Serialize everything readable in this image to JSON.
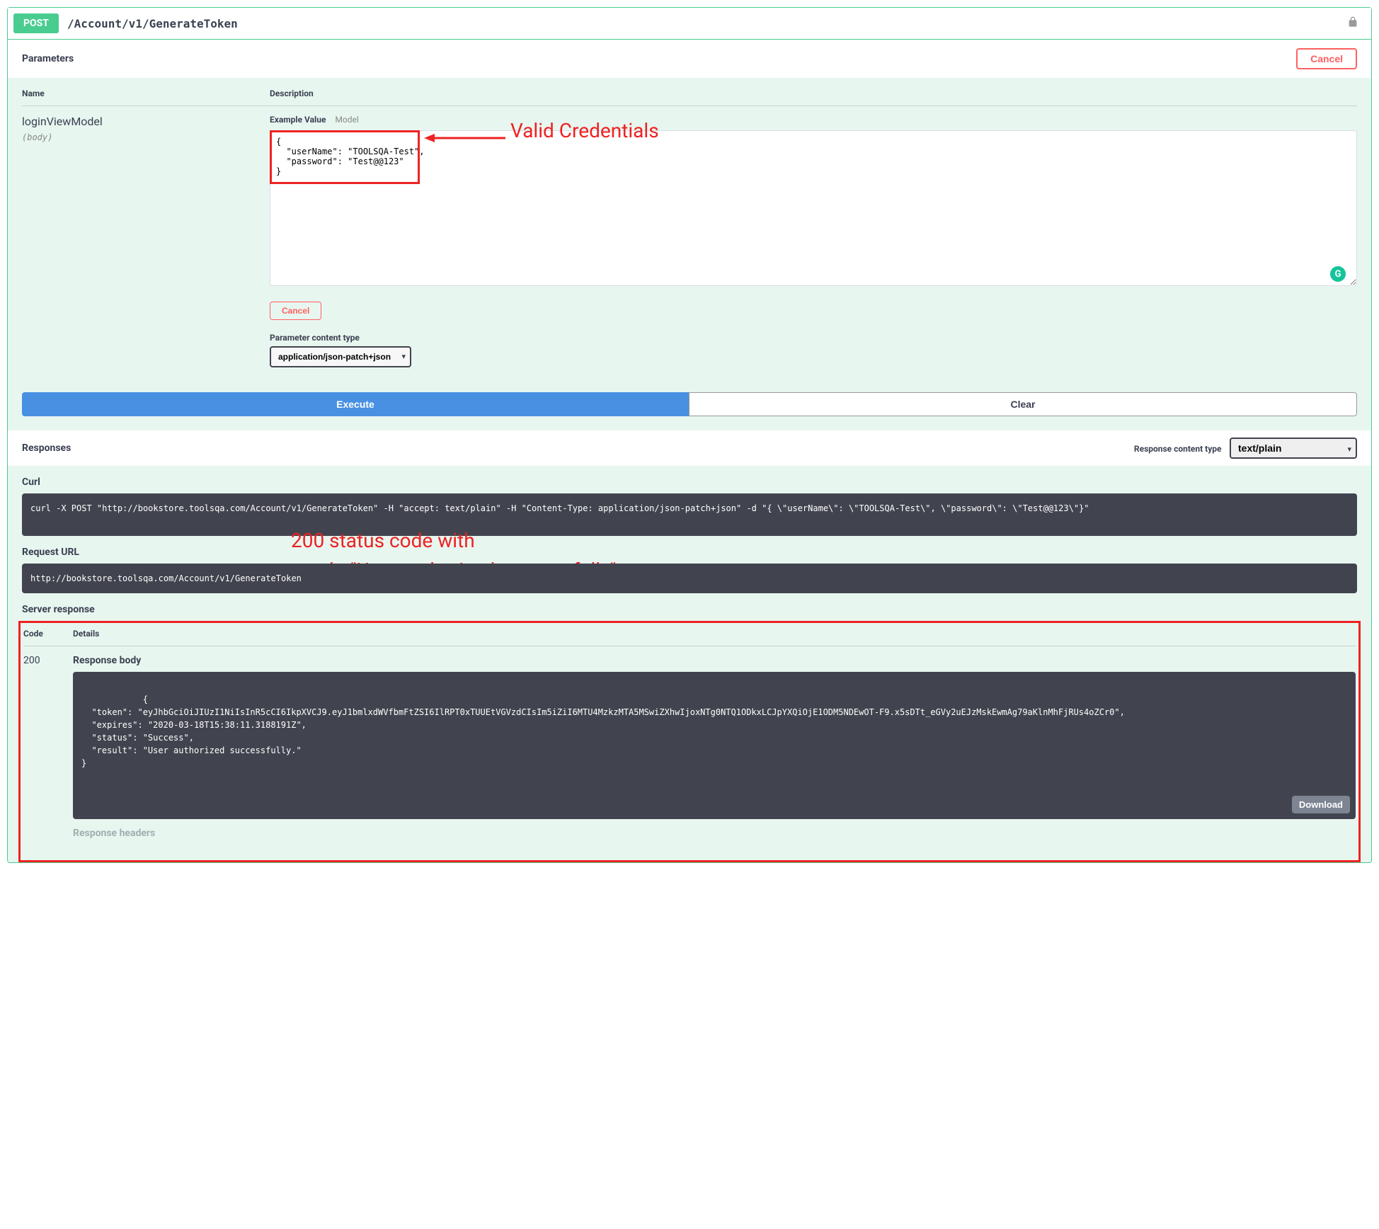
{
  "summary": {
    "method": "POST",
    "path": "/Account/v1/GenerateToken"
  },
  "parameters": {
    "title": "Parameters",
    "cancel": "Cancel",
    "head_name": "Name",
    "head_desc": "Description",
    "param_name": "loginViewModel",
    "param_in": "(body)",
    "tab_example": "Example Value",
    "tab_model": "Model",
    "body_value": "{\n  \"userName\": \"TOOLSQA-Test\",\n  \"password\": \"Test@@123\"\n}",
    "cancel_small": "Cancel",
    "content_type_label": "Parameter content type",
    "content_type_value": "application/json-patch+json"
  },
  "buttons": {
    "execute": "Execute",
    "clear": "Clear"
  },
  "responses": {
    "title": "Responses",
    "ct_label": "Response content type",
    "ct_value": "text/plain"
  },
  "curl": {
    "title": "Curl",
    "value": "curl -X POST \"http://bookstore.toolsqa.com/Account/v1/GenerateToken\" -H \"accept: text/plain\" -H \"Content-Type: application/json-patch+json\" -d \"{ \\\"userName\\\": \\\"TOOLSQA-Test\\\", \\\"password\\\": \\\"Test@@123\\\"}\""
  },
  "request_url": {
    "title": "Request URL",
    "value": "http://bookstore.toolsqa.com/Account/v1/GenerateToken"
  },
  "server_response": {
    "title": "Server response",
    "head_code": "Code",
    "head_details": "Details",
    "status": "200",
    "body_label": "Response body",
    "body_value": "{\n  \"token\": \"eyJhbGciOiJIUzI1NiIsInR5cCI6IkpXVCJ9.eyJ1bmlxdWVfbmFtZSI6IlRPT0xTUUEtVGVzdCIsIm5iZiI6MTU4MzkzMTA5MSwiZXhwIjoxNTg0NTQ1ODkxLCJpYXQiOjE1ODM5NDEwOT-F9.x5sDTt_eGVy2uEJzMskEwmAg79aKlnMhFjRUs4oZCr0\",\n  \"expires\": \"2020-03-18T15:38:11.3188191Z\",\n  \"status\": \"Success\",\n  \"result\": \"User authorized successfully.\"\n}",
    "download": "Download",
    "headers_label": "Response headers"
  },
  "annotations": {
    "valid_credentials": "Valid Credentials",
    "status_line1": "200 status code with",
    "status_line2": "result: \"User authorized successfully\""
  },
  "grammarly": "G"
}
